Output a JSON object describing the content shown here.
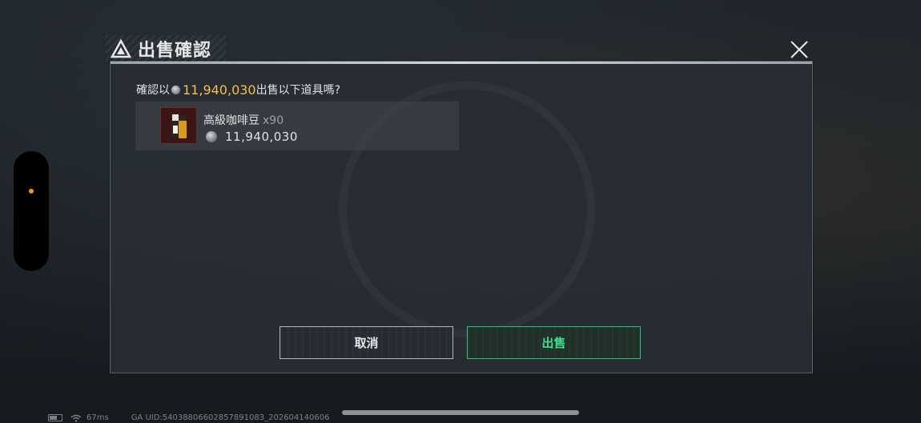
{
  "dialog": {
    "title": "出售確認",
    "prompt_prefix": "確認以",
    "prompt_amount": "11,940,030",
    "prompt_suffix": "出售以下道具嗎?",
    "item": {
      "name": "高級咖啡豆",
      "quantity": "x90",
      "price": "11,940,030"
    },
    "cancel_label": "取消",
    "sell_label": "出售"
  },
  "status_bar": {
    "ping": "67ms",
    "uid": "GA UID:5403880660285789108З_202604140606"
  },
  "icons": {
    "title": "triangle-logo-icon",
    "close": "close-icon",
    "currency": "silver-coin-icon",
    "item": "coffee-bean-bag-icon",
    "battery": "battery-icon",
    "wifi": "wifi-icon"
  },
  "colors": {
    "price_highlight": "#f0c14a",
    "sell_accent": "#2fc27a",
    "notification_dot": "#f39a1c"
  }
}
